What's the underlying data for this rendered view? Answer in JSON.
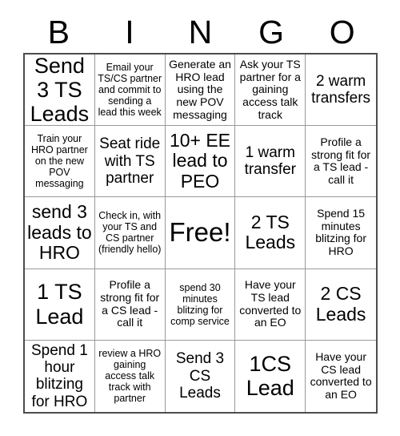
{
  "card": {
    "header_letters": [
      "B",
      "I",
      "N",
      "G",
      "O"
    ],
    "free_space_label": "Free!",
    "rows": [
      [
        {
          "text": "Send 3 TS Leads",
          "size": "xl"
        },
        {
          "text": "Email your TS/CS partner and commit to sending a lead this week",
          "size": "xs"
        },
        {
          "text": "Generate an HRO lead using the new POV messaging",
          "size": "sm"
        },
        {
          "text": "Ask your TS partner for a gaining access talk track",
          "size": "sm"
        },
        {
          "text": "2 warm transfers",
          "size": "md"
        }
      ],
      [
        {
          "text": "Train your HRO partner on the new POV messaging",
          "size": "xs"
        },
        {
          "text": "Seat ride with TS partner",
          "size": "md"
        },
        {
          "text": "10+ EE lead to PEO",
          "size": "lg"
        },
        {
          "text": "1 warm transfer",
          "size": "md"
        },
        {
          "text": "Profile a strong fit for a TS lead - call it",
          "size": "sm"
        }
      ],
      [
        {
          "text": "send 3 leads to HRO",
          "size": "lg"
        },
        {
          "text": "Check in, with your TS and CS partner (friendly hello)",
          "size": "xs"
        },
        {
          "text": "Free!",
          "size": "free"
        },
        {
          "text": "2 TS Leads",
          "size": "lg"
        },
        {
          "text": "Spend 15 minutes blitzing for HRO",
          "size": "sm"
        }
      ],
      [
        {
          "text": "1 TS Lead",
          "size": "xl"
        },
        {
          "text": "Profile a strong fit for a CS lead - call it",
          "size": "sm"
        },
        {
          "text": "spend 30 minutes blitzing for comp service",
          "size": "xs"
        },
        {
          "text": "Have your TS lead converted to an EO",
          "size": "sm"
        },
        {
          "text": "2 CS Leads",
          "size": "lg"
        }
      ],
      [
        {
          "text": "Spend 1 hour blitzing for HRO",
          "size": "md"
        },
        {
          "text": "review a HRO gaining access talk track with partner",
          "size": "xs"
        },
        {
          "text": "Send 3 CS Leads",
          "size": "md"
        },
        {
          "text": "1CS Lead",
          "size": "xl"
        },
        {
          "text": "Have your CS lead converted to an EO",
          "size": "sm"
        }
      ]
    ]
  }
}
